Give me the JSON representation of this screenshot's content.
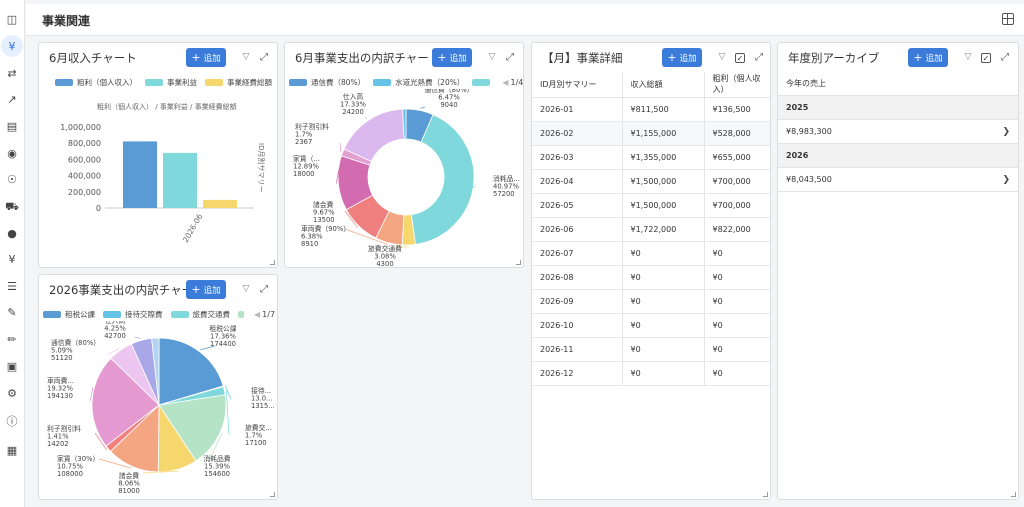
{
  "header": {
    "title": "事業関連"
  },
  "sidebar": {
    "icons": [
      "panel-icon",
      "yen-icon",
      "transfer-icon",
      "chart-icon",
      "report-icon",
      "piggy-icon",
      "person-icon",
      "truck-icon",
      "moneybag-icon",
      "yen-small-icon",
      "coins-icon",
      "pen-icon",
      "pencil-icon",
      "cash-icon",
      "gear-icon",
      "info-icon",
      "apps-icon"
    ]
  },
  "common": {
    "add_label": "追加",
    "plus": "+"
  },
  "income_chart": {
    "title": "6月収入チャート",
    "legend": [
      "粗利（個人収入）",
      "事業利益",
      "事業経費総額"
    ],
    "colors": [
      "#5b9bd5",
      "#7fd8dc",
      "#f5d76e"
    ],
    "y_axis_title": "粗利（個人収入） / 事業利益 / 事業経費総額",
    "y_right_title": "ID月別サマリー",
    "chart_data": {
      "type": "bar",
      "categories": [
        "2026-06"
      ],
      "series": [
        {
          "name": "粗利（個人収入）",
          "values": [
            822000
          ]
        },
        {
          "name": "事業利益",
          "values": [
            680000
          ]
        },
        {
          "name": "事業経費総額",
          "values": [
            100000
          ]
        }
      ],
      "yticks": [
        "1,000,000",
        "800,000",
        "600,000",
        "400,000",
        "200,000",
        "0"
      ],
      "ylim": [
        0,
        1000000
      ]
    }
  },
  "june_expense_chart": {
    "title": "6月事業支出の内訳チャート",
    "legend": [
      "通信費（80%）",
      "水道光熱費（20%）"
    ],
    "legend_colors": [
      "#5b9bd5",
      "#64c3e6",
      "#7fd8dc"
    ],
    "pager": "1/4",
    "chart_data": {
      "type": "pie",
      "slices": [
        {
          "name": "通信費（80%）",
          "pct": "6.47%",
          "value": "9040",
          "color": "#5b9bd5"
        },
        {
          "name": "消耗品...",
          "pct": "40.97%",
          "value": "57200",
          "color": "#7fd8dc"
        },
        {
          "name": "旅費交通費",
          "pct": "3.08%",
          "value": "4300",
          "color": "#f5d76e"
        },
        {
          "name": "車両費（90%）",
          "pct": "6.38%",
          "value": "8910",
          "color": "#f4a582"
        },
        {
          "name": "諸会費",
          "pct": "9.67%",
          "value": "13500",
          "color": "#f08080"
        },
        {
          "name": "家賃（...",
          "pct": "12.89%",
          "value": "18000",
          "color": "#d36bb0"
        },
        {
          "name": "利子割引料",
          "pct": "1.7%",
          "value": "2367",
          "color": "#e39fd0"
        },
        {
          "name": "仕入高",
          "pct": "17.33%",
          "value": "24200",
          "color": "#dbb8ee"
        },
        {
          "name": "",
          "pct": "",
          "value": "1100",
          "color": "#64c3e6"
        }
      ]
    }
  },
  "year_expense_chart": {
    "title": "2026事業支出の内訳チャート",
    "legend": [
      "租税公課",
      "接待交際費",
      "旅費交通費"
    ],
    "legend_colors": [
      "#5b9bd5",
      "#64c3e6",
      "#7fd8dc",
      "#b5e3c5"
    ],
    "pager": "1/7",
    "chart_data": {
      "type": "pie",
      "slices": [
        {
          "name": "租税公課",
          "pct": "17.36%",
          "value": "174400",
          "color": "#5b9bd5"
        },
        {
          "name": "接待...",
          "pct": "13.0...",
          "value": "1315...",
          "color": "#64c3e6"
        },
        {
          "name": "旅費交...",
          "pct": "1.7%",
          "value": "17100",
          "color": "#7fd8dc"
        },
        {
          "name": "消耗品費",
          "pct": "15.39%",
          "value": "154600",
          "color": "#b5e3c5"
        },
        {
          "name": "諸会費",
          "pct": "8.06%",
          "value": "81000",
          "color": "#f5d76e"
        },
        {
          "name": "家賃（30%）",
          "pct": "10.75%",
          "value": "108000",
          "color": "#f4a582"
        },
        {
          "name": "利子割引料",
          "pct": "1.41%",
          "value": "14202",
          "color": "#f08080"
        },
        {
          "name": "車両費...",
          "pct": "19.32%",
          "value": "194130",
          "color": "#e49ad0"
        },
        {
          "name": "通信費（80%）",
          "pct": "5.09%",
          "value": "51120",
          "color": "#ecc6f0"
        },
        {
          "name": "仕入高",
          "pct": "4.25%",
          "value": "42700",
          "color": "#a8a8e8"
        },
        {
          "name": "",
          "pct": "",
          "value": "15000",
          "color": "#b0d4f1"
        }
      ]
    }
  },
  "monthly_table": {
    "title": "【月】事業詳細",
    "headers": [
      "ID月別サマリー",
      "収入総額",
      "粗利（個人収入）"
    ],
    "rows": [
      [
        "2026-01",
        "¥811,500",
        "¥136,500"
      ],
      [
        "2026-02",
        "¥1,155,000",
        "¥528,000"
      ],
      [
        "2026-03",
        "¥1,355,000",
        "¥655,000"
      ],
      [
        "2026-04",
        "¥1,500,000",
        "¥700,000"
      ],
      [
        "2026-05",
        "¥1,500,000",
        "¥700,000"
      ],
      [
        "2026-06",
        "¥1,722,000",
        "¥822,000"
      ],
      [
        "2026-07",
        "¥0",
        "¥0"
      ],
      [
        "2026-08",
        "¥0",
        "¥0"
      ],
      [
        "2026-09",
        "¥0",
        "¥0"
      ],
      [
        "2026-10",
        "¥0",
        "¥0"
      ],
      [
        "2026-11",
        "¥0",
        "¥0"
      ],
      [
        "2026-12",
        "¥0",
        "¥0"
      ]
    ]
  },
  "archive": {
    "title": "年度別アーカイブ",
    "header": "今年の売上",
    "groups": [
      {
        "year": "2025",
        "value": "¥8,983,300"
      },
      {
        "year": "2026",
        "value": "¥8,043,500"
      }
    ]
  }
}
